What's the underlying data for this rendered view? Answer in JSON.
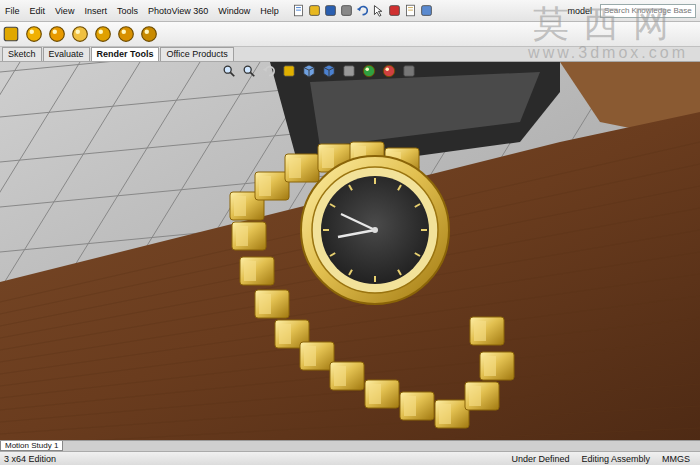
{
  "menu": [
    "File",
    "Edit",
    "View",
    "Insert",
    "Tools",
    "PhotoView 360",
    "Window",
    "Help"
  ],
  "document_name": "model",
  "search": {
    "placeholder": "Search Knowledge Base"
  },
  "tabs": [
    {
      "label": "Sketch",
      "selected": false
    },
    {
      "label": "Evaluate",
      "selected": false
    },
    {
      "label": "Render Tools",
      "selected": true
    },
    {
      "label": "Office Products",
      "selected": false
    }
  ],
  "watermark": {
    "title": "莫西网",
    "url": "www.3dmox.com"
  },
  "motion_tab": {
    "label": "Motion Study 1",
    "selected": true
  },
  "status_bar": [
    "3 x64 Edition",
    "Under Defined",
    "Editing Assembly",
    "MMGS"
  ]
}
